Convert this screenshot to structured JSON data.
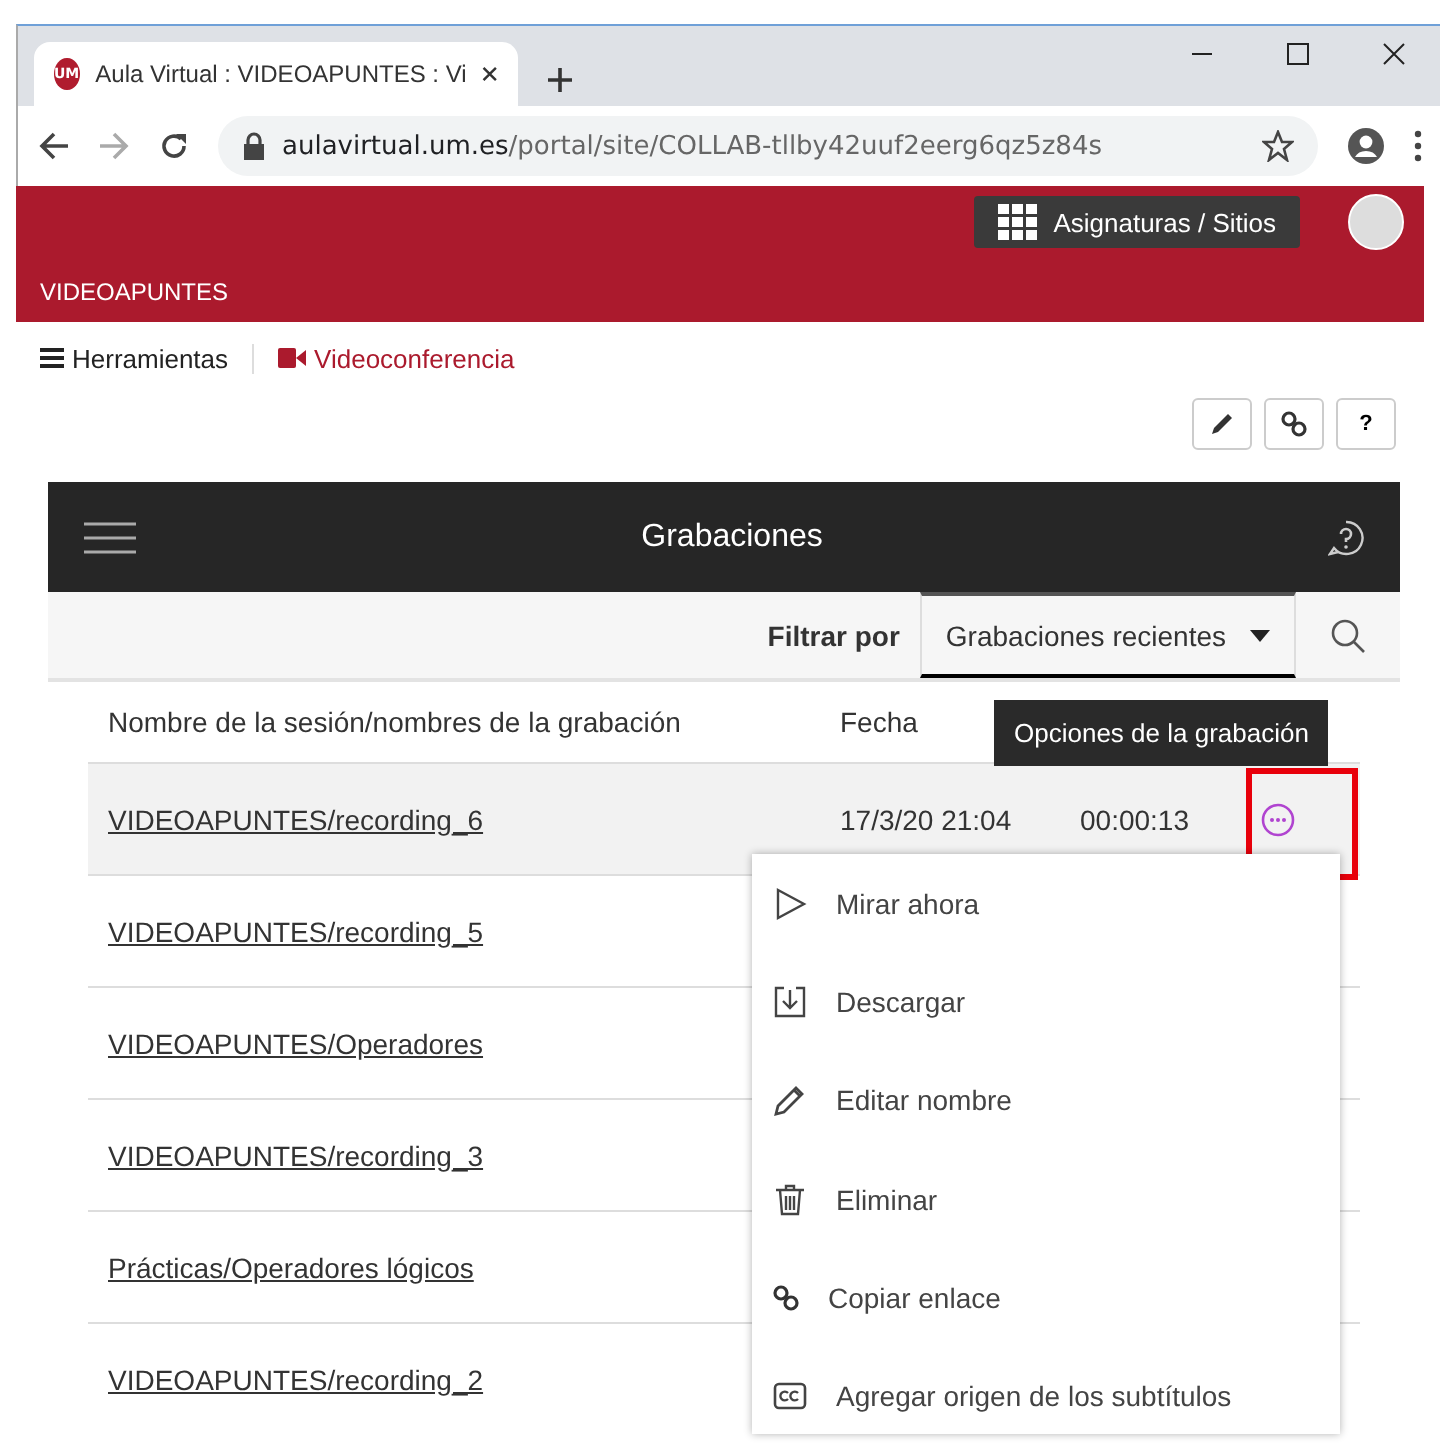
{
  "browser": {
    "favicon_text": "UM",
    "tab_title": "Aula Virtual : VIDEOAPUNTES : Vi",
    "url_host": "aulavirtual.um.es",
    "url_path": "/portal/site/COLLAB-tllby42uuf2eerg6qz5z84s"
  },
  "site": {
    "sites_button": "Asignaturas / Sitios",
    "site_title": "VIDEOAPUNTES",
    "nav": [
      {
        "label": "Herramientas",
        "kind": "menu"
      },
      {
        "label": "Videoconferencia",
        "kind": "video"
      }
    ],
    "tool_buttons": [
      {
        "kind": "edit"
      },
      {
        "kind": "link"
      },
      {
        "kind": "help",
        "label": "?"
      }
    ]
  },
  "panel": {
    "title": "Grabaciones",
    "filter_label": "Filtrar por",
    "filter_value": "Grabaciones recientes",
    "columns": [
      "Nombre de la sesión/nombres de la grabación",
      "Fecha"
    ],
    "rows": [
      {
        "name": "VIDEOAPUNTES/recording_6",
        "date": "17/3/20 21:04",
        "duration": "00:00:13",
        "selected": true
      },
      {
        "name": "VIDEOAPUNTES/recording_5",
        "selected": false
      },
      {
        "name": "VIDEOAPUNTES/Operadores",
        "selected": false
      },
      {
        "name": "VIDEOAPUNTES/recording_3",
        "selected": false
      },
      {
        "name": "Prácticas/Operadores lógicos",
        "selected": false
      },
      {
        "name": "VIDEOAPUNTES/recording_2",
        "selected": false
      }
    ],
    "tooltip": "Opciones de la grabación",
    "menu": [
      {
        "label": "Mirar ahora",
        "kind": "play"
      },
      {
        "label": "Descargar",
        "kind": "download"
      },
      {
        "label": "Editar nombre",
        "kind": "edit"
      },
      {
        "label": "Eliminar",
        "kind": "delete"
      },
      {
        "label": "Copiar enlace",
        "kind": "link"
      },
      {
        "label": "Agregar origen de los subtítulos",
        "kind": "captions"
      }
    ]
  }
}
